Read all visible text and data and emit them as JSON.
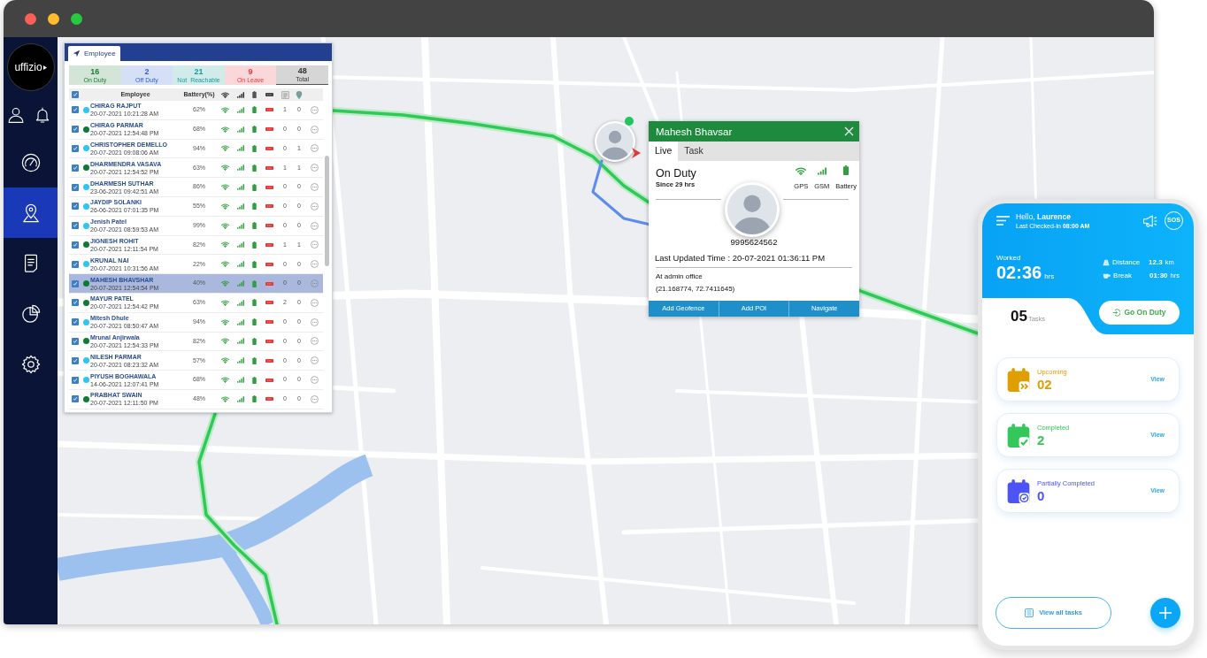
{
  "window": {
    "controls": [
      {
        "color": "#fe5f57"
      },
      {
        "color": "#febc2e"
      },
      {
        "color": "#28c840"
      }
    ]
  },
  "sidebar": {
    "logo": "uffizio",
    "top_icons": [
      {
        "kind": "profile"
      },
      {
        "kind": "alerts"
      }
    ],
    "items": [
      {
        "kind": "dashboard",
        "selected": false
      },
      {
        "kind": "tracking",
        "selected": true
      },
      {
        "kind": "reports",
        "selected": false
      },
      {
        "kind": "analytics",
        "selected": false
      },
      {
        "kind": "settings",
        "selected": false
      }
    ]
  },
  "employee_panel": {
    "tab": "Employee",
    "summary": [
      {
        "count": "16",
        "label": "On Duty",
        "color": "#1e7b36",
        "selected": false
      },
      {
        "count": "2",
        "label": "Off Duty",
        "color": "#2f5fd0",
        "selected": false
      },
      {
        "count": "21",
        "label": "Not  Reachable",
        "color": "#179c9c",
        "selected": false
      },
      {
        "count": "9",
        "label": "On Leave",
        "color": "#e8383d",
        "selected": false
      },
      {
        "count": "48",
        "label": "Total",
        "color": "#333333",
        "selected": true
      }
    ],
    "columns": [
      "Employee",
      "Battery(%)"
    ],
    "all_checked": true,
    "rows": [
      {
        "name": "CHIRAG RAJPUT",
        "time": "20-07-2021 10:21:28 AM",
        "color": "#2ec5f0",
        "battery": "62%",
        "column_9": "1",
        "column_10": "0",
        "checked": true,
        "selected": false
      },
      {
        "name": "CHIRAG PARMAR",
        "time": "20-07-2021 12:54:48 PM",
        "color": "#0f7a33",
        "battery": "68%",
        "column_9": "0",
        "column_10": "0",
        "checked": true,
        "selected": false
      },
      {
        "name": "CHRISTOPHER DEMELLO",
        "time": "20-07-2021 09:08:06 AM",
        "color": "#2ec5f0",
        "battery": "94%",
        "column_9": "0",
        "column_10": "1",
        "checked": true,
        "selected": false
      },
      {
        "name": "DHARMENDRA VASAVA",
        "time": "20-07-2021 12:54:52 PM",
        "color": "#0f7a33",
        "battery": "63%",
        "column_9": "1",
        "column_10": "1",
        "checked": true,
        "selected": false
      },
      {
        "name": "DHARMESH SUTHAR",
        "time": "23-06-2021 09:42:51 AM",
        "color": "#2ec5f0",
        "battery": "86%",
        "column_9": "0",
        "column_10": "0",
        "checked": true,
        "selected": false
      },
      {
        "name": "JAYDIP SOLANKI",
        "time": "26-06-2021 07:01:35 PM",
        "color": "#2ec5f0",
        "battery": "55%",
        "column_9": "0",
        "column_10": "0",
        "checked": true,
        "selected": false
      },
      {
        "name": "Jenish Patel",
        "time": "20-07-2021 08:59:53 AM",
        "color": "#2ec5f0",
        "battery": "99%",
        "column_9": "0",
        "column_10": "0",
        "checked": true,
        "selected": false
      },
      {
        "name": "JIGNESH ROHIT",
        "time": "20-07-2021 12:11:54 PM",
        "color": "#0f7a33",
        "battery": "82%",
        "column_9": "1",
        "column_10": "1",
        "checked": true,
        "selected": false
      },
      {
        "name": "KRUNAL NAI",
        "time": "20-07-2021 10:31:56 AM",
        "color": "#2ec5f0",
        "battery": "22%",
        "column_9": "0",
        "column_10": "0",
        "checked": true,
        "selected": false
      },
      {
        "name": "MAHESH BHAVSHAR",
        "time": "20-07-2021 12:54:54 PM",
        "color": "#0f7a33",
        "battery": "40%",
        "column_9": "0",
        "column_10": "0",
        "checked": true,
        "selected": true
      },
      {
        "name": "MAYUR PATEL",
        "time": "20-07-2021 12:54:42 PM",
        "color": "#0f7a33",
        "battery": "63%",
        "column_9": "2",
        "column_10": "0",
        "checked": true,
        "selected": false
      },
      {
        "name": "Mitesh Dhule",
        "time": "20-07-2021 08:50:47 AM",
        "color": "#2ec5f0",
        "battery": "94%",
        "column_9": "0",
        "column_10": "0",
        "checked": true,
        "selected": false
      },
      {
        "name": "Mrunal Anjirwala",
        "time": "20-07-2021 12:54:33 PM",
        "color": "#0f7a33",
        "battery": "82%",
        "column_9": "0",
        "column_10": "0",
        "checked": true,
        "selected": false
      },
      {
        "name": "NILESH PARMAR",
        "time": "20-07-2021 08:23:32 AM",
        "color": "#2ec5f0",
        "battery": "57%",
        "column_9": "0",
        "column_10": "0",
        "checked": true,
        "selected": false
      },
      {
        "name": "PIYUSH BOGHAWALA",
        "time": "14-06-2021 12:07:41 PM",
        "color": "#2ec5f0",
        "battery": "68%",
        "column_9": "0",
        "column_10": "0",
        "checked": true,
        "selected": false
      },
      {
        "name": "PRABHAT SWAIN",
        "time": "20-07-2021 12:11:50 PM",
        "color": "#0f7a33",
        "battery": "48%",
        "column_9": "0",
        "column_10": "0",
        "checked": true,
        "selected": false
      }
    ]
  },
  "popup": {
    "title": "Mahesh Bhavsar",
    "tabs": [
      {
        "label": "Live",
        "selected": true
      },
      {
        "label": "Task",
        "selected": false
      }
    ],
    "status": "On Duty",
    "since": "Since 29 hrs",
    "indicators": [
      {
        "kind": "gps",
        "label": "GPS"
      },
      {
        "kind": "gsm",
        "label": "GSM"
      },
      {
        "kind": "battery",
        "label": "Battery"
      }
    ],
    "phone": "9995624562",
    "last_updated": "Last Updated Time : 20-07-2021 01:36:11 PM",
    "address": "At admin office",
    "coordinates": "(21.168774, 72.7411645)",
    "actions": [
      "Add Geofence",
      "Add POI",
      "Navigate"
    ]
  },
  "phone": {
    "greeting": "Hello, **Laurence**",
    "last_checked": "Last Checked-In **08:00 AM**",
    "sos": "SOS",
    "worked_label": "Worked",
    "worked": "02:36",
    "worked_unit": "hrs",
    "stats": [
      {
        "kind": "distance",
        "label": "Distance",
        "value": "12.3",
        "unit": "km"
      },
      {
        "kind": "break",
        "label": "Break",
        "value": "01:30",
        "unit": "hrs"
      }
    ],
    "task_count": "05",
    "task_label": "Tasks",
    "duty_button": "Go On Duty",
    "cards": [
      {
        "kind": "upcoming",
        "label": "Upcoming",
        "count": "02",
        "color": "#e09f00",
        "link": "View"
      },
      {
        "kind": "completed",
        "label": "Completed",
        "count": "2",
        "color": "#34c759",
        "link": "View"
      },
      {
        "kind": "partial",
        "label": "Partially Completed",
        "count": "0",
        "color": "#4b55f5",
        "link": "View"
      }
    ],
    "view_all": "View all tasks"
  }
}
